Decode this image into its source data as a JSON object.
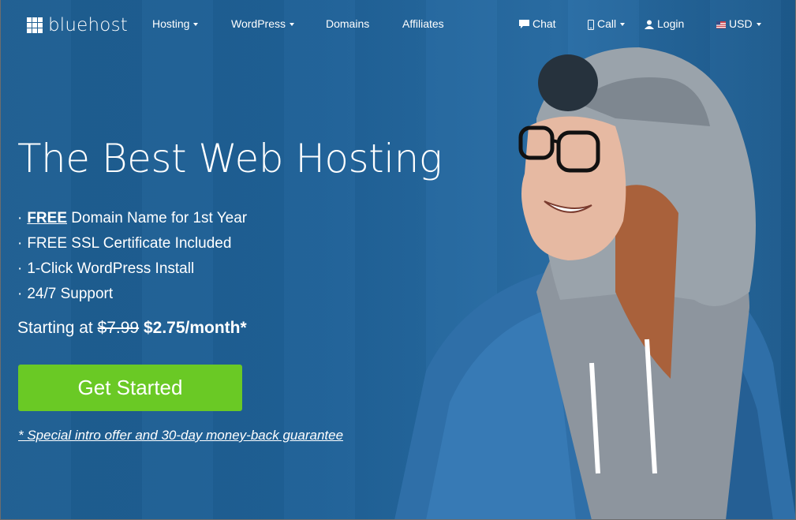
{
  "brand": {
    "name": "bluehost"
  },
  "nav": {
    "hosting": "Hosting",
    "wordpress": "WordPress",
    "domains": "Domains",
    "affiliates": "Affiliates",
    "chat": "Chat",
    "call": "Call",
    "login": "Login",
    "currency": "USD"
  },
  "hero": {
    "headline": "The Best Web Hosting",
    "bullets": [
      {
        "bullet": "·",
        "highlight": "FREE",
        "text": " Domain Name for 1st Year"
      },
      {
        "bullet": "·",
        "text": "FREE SSL Certificate Included"
      },
      {
        "bullet": "·",
        "text": "1-Click WordPress Install"
      },
      {
        "bullet": "·",
        "text": "24/7 Support"
      }
    ],
    "pricing": {
      "prefix": "Starting at ",
      "old_price": "$7.99",
      "new_price": "$2.75/month*"
    },
    "cta_label": "Get Started",
    "guarantee": "* Special intro offer and 30-day money-back guarantee"
  },
  "colors": {
    "background": "#1f5f93",
    "cta": "#6ac925",
    "text": "#ffffff"
  },
  "icons": {
    "logo": "grid-logo-icon",
    "chat": "chat-bubble-icon",
    "call": "phone-icon",
    "login": "user-icon",
    "currency": "us-flag-icon"
  }
}
